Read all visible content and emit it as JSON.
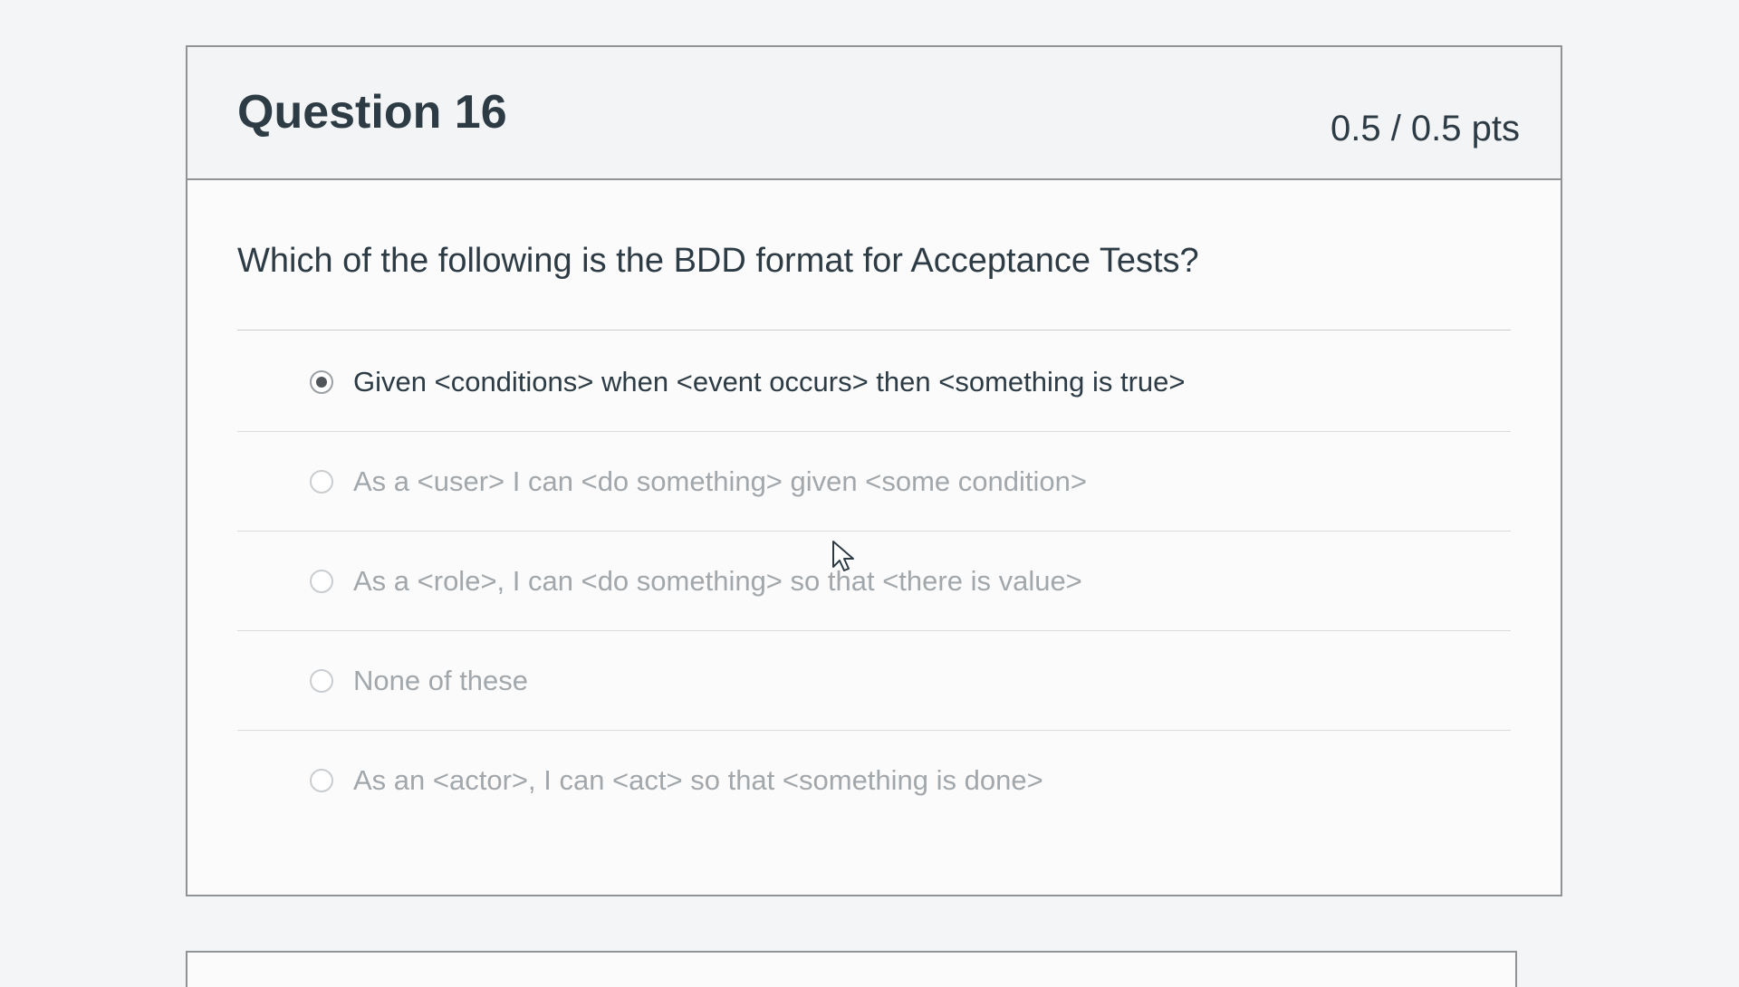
{
  "question": {
    "title": "Question 16",
    "points": "0.5 / 0.5 pts",
    "text": "Which of the following is the BDD format for Acceptance Tests?"
  },
  "answers": [
    {
      "label": "Given <conditions> when <event occurs> then <something is true>",
      "selected": true
    },
    {
      "label": "As a <user> I can <do something> given <some condition>",
      "selected": false
    },
    {
      "label": "As a <role>, I can <do something> so that <there is value>",
      "selected": false
    },
    {
      "label": "None of these",
      "selected": false
    },
    {
      "label": "As an <actor>, I can <act> so that <something is done>",
      "selected": false
    }
  ],
  "icons": {
    "cursor": "mouse-pointer-icon",
    "radio": "radio-button-icon"
  },
  "colors": {
    "text_primary": "#2d3b45",
    "text_muted": "#a2a7ab",
    "border": "#8f9396"
  }
}
